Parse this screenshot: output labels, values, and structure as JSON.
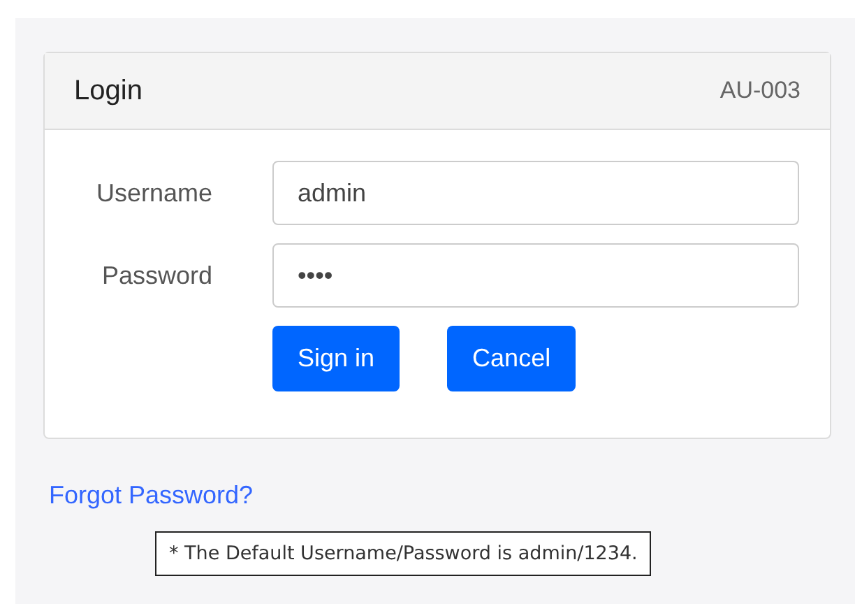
{
  "card": {
    "title": "Login",
    "code": "AU-003"
  },
  "fields": [
    {
      "label": "Username",
      "value": "admin"
    },
    {
      "label": "Password",
      "value": "••••"
    }
  ],
  "buttons": [
    "Sign in",
    "Cancel"
  ],
  "forgot_link": "Forgot Password?",
  "tooltip": "* The Default Username/Password is admin/1234."
}
